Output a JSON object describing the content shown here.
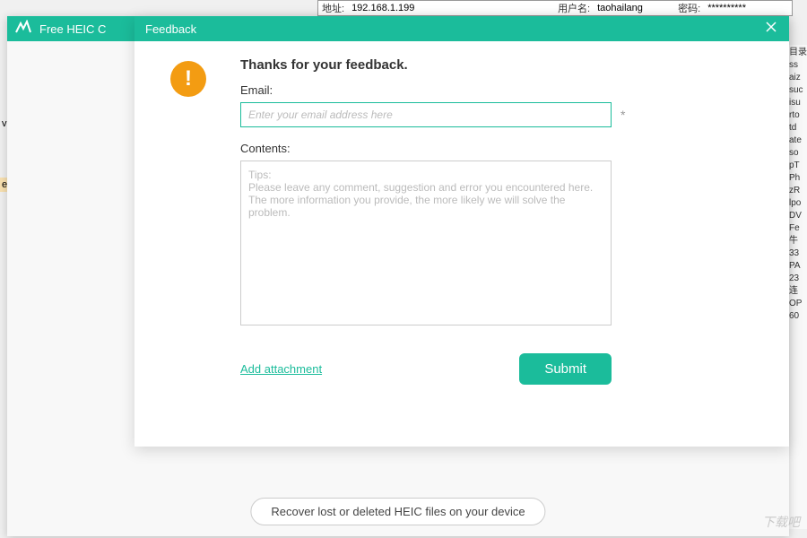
{
  "bg": {
    "addr_label": "地址:",
    "addr_value": "192.168.1.199",
    "user_label": "用户名:",
    "user_value": "taohailang",
    "pwd_label": "密码:",
    "pwd_value": "**********",
    "left1": "ve",
    "left2": "e-",
    "right_items": [
      "目录",
      "ss",
      "aiz",
      "suc",
      "isu",
      "rto",
      "td",
      "ate",
      "so",
      "pT",
      "Ph",
      "zR",
      "lpo",
      "DV",
      "Fe",
      "",
      "牛",
      "33",
      "PA",
      "23",
      "连",
      "OP",
      "60"
    ]
  },
  "app": {
    "title": "Free HEIC C",
    "recover_btn": "Recover lost or deleted HEIC files on your device"
  },
  "modal": {
    "title": "Feedback",
    "heading": "Thanks for your feedback.",
    "email_label": "Email:",
    "email_placeholder": "Enter your email address here",
    "asterisk": "*",
    "contents_label": "Contents:",
    "contents_placeholder": "Tips:\nPlease leave any comment, suggestion and error you encountered here. The more information you provide, the more likely we will solve the problem.",
    "attach": "Add attachment",
    "submit": "Submit"
  },
  "colors": {
    "accent": "#1bbc9b",
    "warning": "#f39c12"
  }
}
